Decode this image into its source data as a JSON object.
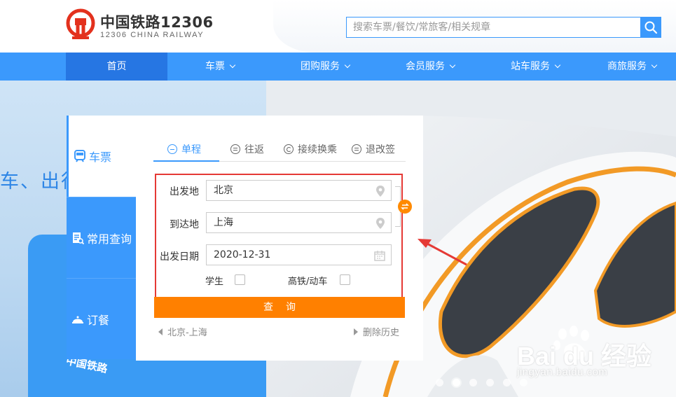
{
  "brand": {
    "title": "中国铁路12306",
    "subtitle": "12306 CHINA RAILWAY"
  },
  "search": {
    "placeholder": "搜索车票/餐饮/常旅客/相关规章",
    "icon": "search-icon"
  },
  "nav": {
    "items": [
      {
        "label": "首页",
        "active": true
      },
      {
        "label": "车票"
      },
      {
        "label": "团购服务"
      },
      {
        "label": "会员服务"
      },
      {
        "label": "站车服务"
      },
      {
        "label": "商旅服务"
      }
    ]
  },
  "banner": {
    "slogan": "车、出行",
    "railway_label": "中国铁路",
    "dot_count": 6,
    "active_dot": 1
  },
  "side_tabs": [
    {
      "label": "车票",
      "icon": "train-icon",
      "active": true
    },
    {
      "label": "常用查询",
      "icon": "document-search-icon"
    },
    {
      "label": "订餐",
      "icon": "meal-icon"
    }
  ],
  "trip_tabs": [
    {
      "label": "单程",
      "icon": "minus-circle-icon",
      "active": true
    },
    {
      "label": "往返",
      "icon": "equal-circle-icon"
    },
    {
      "label": "接续换乘",
      "icon": "refresh-circle-icon"
    },
    {
      "label": "退改签",
      "icon": "list-circle-icon"
    }
  ],
  "form": {
    "from_label": "出发地",
    "from_value": "北京",
    "to_label": "到达地",
    "to_value": "上海",
    "date_label": "出发日期",
    "date_value": "2020-12-31",
    "student_label": "学生",
    "highspeed_label": "高铁/动车",
    "query_label": "查询"
  },
  "history": {
    "last_route": "北京-上海",
    "delete_label": "删除历史"
  },
  "watermark": {
    "brand_text": "Bai du 经验",
    "url": "jingyan.baidu.com"
  },
  "colors": {
    "primary": "#3b99fc",
    "nav_active": "#2676e3",
    "accent_orange": "#ff8000",
    "highlight_red": "#e53935"
  }
}
